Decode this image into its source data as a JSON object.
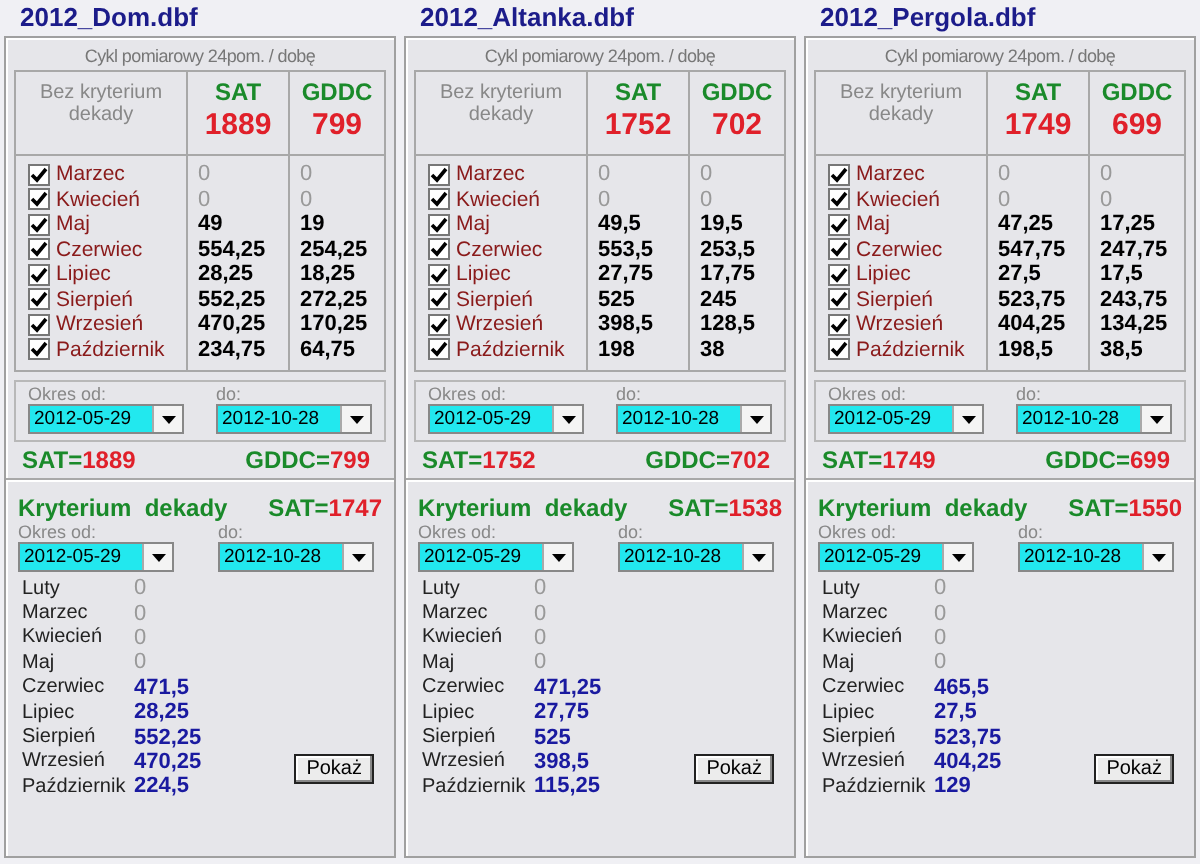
{
  "panels": [
    {
      "title": "2012_Dom.dbf",
      "caption": "Cykl pomiarowy 24pom. / dobę",
      "no_criterion_label": "Bez kryterium dekady",
      "columns": [
        {
          "label": "SAT",
          "total": "1889"
        },
        {
          "label": "GDDC",
          "total": "799"
        }
      ],
      "months": [
        {
          "name": "Marzec",
          "checked": true,
          "muted": true,
          "sat": "0",
          "gddc": "0"
        },
        {
          "name": "Kwiecień",
          "checked": true,
          "muted": true,
          "sat": "0",
          "gddc": "0"
        },
        {
          "name": "Maj",
          "checked": true,
          "muted": false,
          "sat": "49",
          "gddc": "19"
        },
        {
          "name": "Czerwiec",
          "checked": true,
          "muted": false,
          "sat": "554,25",
          "gddc": "254,25"
        },
        {
          "name": "Lipiec",
          "checked": true,
          "muted": false,
          "sat": "28,25",
          "gddc": "18,25"
        },
        {
          "name": "Sierpień",
          "checked": true,
          "muted": false,
          "sat": "552,25",
          "gddc": "272,25"
        },
        {
          "name": "Wrzesień",
          "checked": true,
          "muted": false,
          "sat": "470,25",
          "gddc": "170,25"
        },
        {
          "name": "Październik",
          "checked": true,
          "muted": false,
          "sat": "234,75",
          "gddc": "64,75"
        }
      ],
      "period": {
        "from_label": "Okres od:",
        "from": "2012-05-29",
        "to_label": "do:",
        "to": "2012-10-28"
      },
      "totals": [
        {
          "label": "SAT=",
          "value": "1889"
        },
        {
          "label": "GDDC=",
          "value": "799"
        }
      ],
      "criterion": {
        "title": "Kryterium  dekady",
        "sat_label": "SAT=",
        "sat_value": "1747",
        "period": {
          "from_label": "Okres od:",
          "from": "2012-05-29",
          "to_label": "do:",
          "to": "2012-10-28"
        },
        "rows": [
          {
            "name": "Luty",
            "value": "0",
            "muted": true
          },
          {
            "name": "Marzec",
            "value": "0",
            "muted": true
          },
          {
            "name": "Kwiecień",
            "value": "0",
            "muted": true
          },
          {
            "name": "Maj",
            "value": "0",
            "muted": true
          },
          {
            "name": "Czerwiec",
            "value": "471,5",
            "muted": false
          },
          {
            "name": "Lipiec",
            "value": "28,25",
            "muted": false
          },
          {
            "name": "Sierpień",
            "value": "552,25",
            "muted": false
          },
          {
            "name": "Wrzesień",
            "value": "470,25",
            "muted": false
          },
          {
            "name": "Październik",
            "value": "224,5",
            "muted": false
          }
        ],
        "button": "Pokaż"
      }
    },
    {
      "title": "2012_Altanka.dbf",
      "caption": "Cykl pomiarowy 24pom. / dobę",
      "no_criterion_label": "Bez kryterium dekady",
      "columns": [
        {
          "label": "SAT",
          "total": "1752"
        },
        {
          "label": "GDDC",
          "total": "702"
        }
      ],
      "months": [
        {
          "name": "Marzec",
          "checked": true,
          "muted": true,
          "sat": "0",
          "gddc": "0"
        },
        {
          "name": "Kwiecień",
          "checked": true,
          "muted": true,
          "sat": "0",
          "gddc": "0"
        },
        {
          "name": "Maj",
          "checked": true,
          "muted": false,
          "sat": "49,5",
          "gddc": "19,5"
        },
        {
          "name": "Czerwiec",
          "checked": true,
          "muted": false,
          "sat": "553,5",
          "gddc": "253,5"
        },
        {
          "name": "Lipiec",
          "checked": true,
          "muted": false,
          "sat": "27,75",
          "gddc": "17,75"
        },
        {
          "name": "Sierpień",
          "checked": true,
          "muted": false,
          "sat": "525",
          "gddc": "245"
        },
        {
          "name": "Wrzesień",
          "checked": true,
          "muted": false,
          "sat": "398,5",
          "gddc": "128,5"
        },
        {
          "name": "Październik",
          "checked": true,
          "muted": false,
          "sat": "198",
          "gddc": "38"
        }
      ],
      "period": {
        "from_label": "Okres od:",
        "from": "2012-05-29",
        "to_label": "do:",
        "to": "2012-10-28"
      },
      "totals": [
        {
          "label": "SAT=",
          "value": "1752"
        },
        {
          "label": "GDDC=",
          "value": "702"
        }
      ],
      "criterion": {
        "title": "Kryterium  dekady",
        "sat_label": "SAT=",
        "sat_value": "1538",
        "period": {
          "from_label": "Okres od:",
          "from": "2012-05-29",
          "to_label": "do:",
          "to": "2012-10-28"
        },
        "rows": [
          {
            "name": "Luty",
            "value": "0",
            "muted": true
          },
          {
            "name": "Marzec",
            "value": "0",
            "muted": true
          },
          {
            "name": "Kwiecień",
            "value": "0",
            "muted": true
          },
          {
            "name": "Maj",
            "value": "0",
            "muted": true
          },
          {
            "name": "Czerwiec",
            "value": "471,25",
            "muted": false
          },
          {
            "name": "Lipiec",
            "value": "27,75",
            "muted": false
          },
          {
            "name": "Sierpień",
            "value": "525",
            "muted": false
          },
          {
            "name": "Wrzesień",
            "value": "398,5",
            "muted": false
          },
          {
            "name": "Październik",
            "value": "115,25",
            "muted": false
          }
        ],
        "button": "Pokaż"
      }
    },
    {
      "title": "2012_Pergola.dbf",
      "caption": "Cykl pomiarowy 24pom. / dobę",
      "no_criterion_label": "Bez kryterium dekady",
      "columns": [
        {
          "label": "SAT",
          "total": "1749"
        },
        {
          "label": "GDDC",
          "total": "699"
        }
      ],
      "months": [
        {
          "name": "Marzec",
          "checked": true,
          "muted": true,
          "sat": "0",
          "gddc": "0"
        },
        {
          "name": "Kwiecień",
          "checked": true,
          "muted": true,
          "sat": "0",
          "gddc": "0"
        },
        {
          "name": "Maj",
          "checked": true,
          "muted": false,
          "sat": "47,25",
          "gddc": "17,25"
        },
        {
          "name": "Czerwiec",
          "checked": true,
          "muted": false,
          "sat": "547,75",
          "gddc": "247,75"
        },
        {
          "name": "Lipiec",
          "checked": true,
          "muted": false,
          "sat": "27,5",
          "gddc": "17,5"
        },
        {
          "name": "Sierpień",
          "checked": true,
          "muted": false,
          "sat": "523,75",
          "gddc": "243,75"
        },
        {
          "name": "Wrzesień",
          "checked": true,
          "muted": false,
          "sat": "404,25",
          "gddc": "134,25"
        },
        {
          "name": "Październik",
          "checked": true,
          "muted": false,
          "sat": "198,5",
          "gddc": "38,5"
        }
      ],
      "period": {
        "from_label": "Okres od:",
        "from": "2012-05-29",
        "to_label": "do:",
        "to": "2012-10-28"
      },
      "totals": [
        {
          "label": "SAT=",
          "value": "1749"
        },
        {
          "label": "GDDC=",
          "value": "699"
        }
      ],
      "criterion": {
        "title": "Kryterium  dekady",
        "sat_label": "SAT=",
        "sat_value": "1550",
        "period": {
          "from_label": "Okres od:",
          "from": "2012-05-29",
          "to_label": "do:",
          "to": "2012-10-28"
        },
        "rows": [
          {
            "name": "Luty",
            "value": "0",
            "muted": true
          },
          {
            "name": "Marzec",
            "value": "0",
            "muted": true
          },
          {
            "name": "Kwiecień",
            "value": "0",
            "muted": true
          },
          {
            "name": "Maj",
            "value": "0",
            "muted": true
          },
          {
            "name": "Czerwiec",
            "value": "465,5",
            "muted": false
          },
          {
            "name": "Lipiec",
            "value": "27,5",
            "muted": false
          },
          {
            "name": "Sierpień",
            "value": "523,75",
            "muted": false
          },
          {
            "name": "Wrzesień",
            "value": "404,25",
            "muted": false
          },
          {
            "name": "Październik",
            "value": "129",
            "muted": false
          }
        ],
        "button": "Pokaż"
      }
    }
  ]
}
